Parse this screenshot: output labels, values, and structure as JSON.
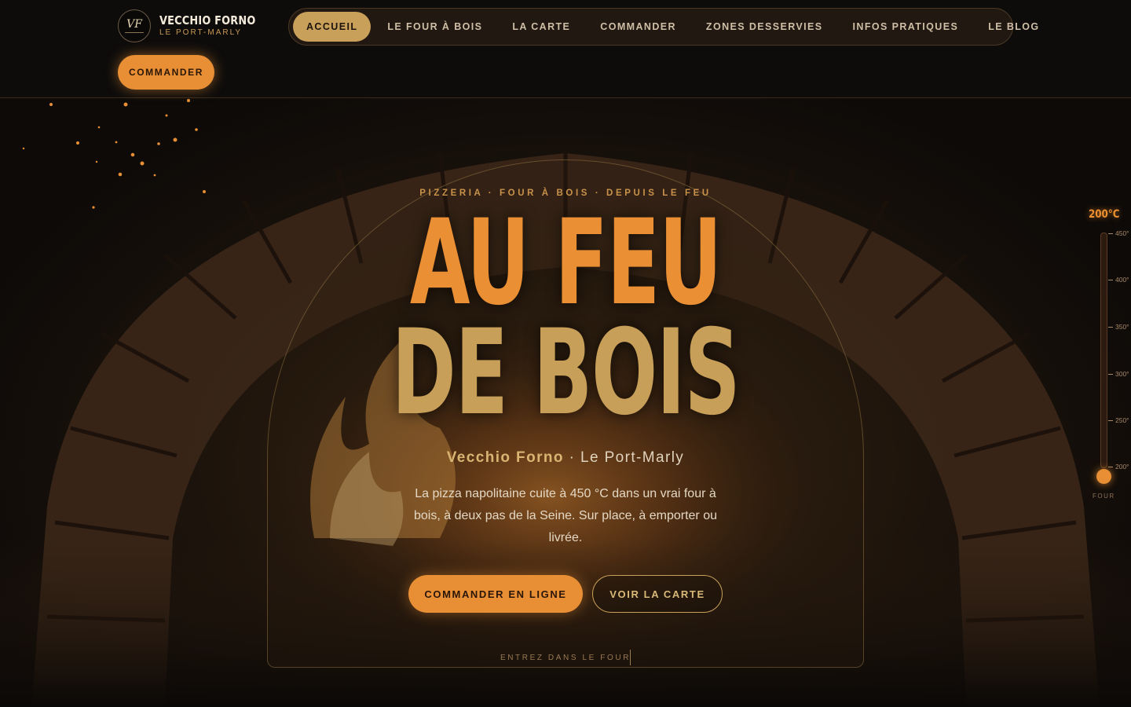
{
  "brand": {
    "monogram": "VF",
    "name": "VECCHIO FORNO",
    "location": "LE PORT-MARLY"
  },
  "nav": {
    "items": [
      {
        "label": "ACCUEIL",
        "active": true
      },
      {
        "label": "LE FOUR À BOIS",
        "active": false
      },
      {
        "label": "LA CARTE",
        "active": false
      },
      {
        "label": "COMMANDER",
        "active": false
      },
      {
        "label": "ZONES DESSERVIES",
        "active": false
      },
      {
        "label": "INFOS PRATIQUES",
        "active": false
      },
      {
        "label": "LE BLOG",
        "active": false
      }
    ]
  },
  "header_cta": {
    "label": "COMMANDER"
  },
  "hero": {
    "eyebrow": "PIZZERIA · FOUR À BOIS · DEPUIS LE FEU",
    "title_line1": "AU FEU",
    "title_line2": "DE BOIS",
    "subtitle_name": "Vecchio Forno",
    "subtitle_sep": " · ",
    "subtitle_place": "Le Port-Marly",
    "lead": "La pizza napolitaine cuite à 450 °C dans un vrai four à bois, à deux pas de la Seine. Sur place, à emporter ou livrée.",
    "primary_button": "COMMANDER EN LIGNE",
    "secondary_button": "VOIR LA CARTE",
    "scroll_cue": "ENTREZ DANS LE FOUR"
  },
  "thermometer": {
    "readout": "200°C",
    "value": 200,
    "min": 200,
    "max": 450,
    "ticks": [
      "450°",
      "400°",
      "350°",
      "300°",
      "250°",
      "200°"
    ],
    "label": "FOUR"
  },
  "colors": {
    "accent": "#e88f35",
    "gold": "#c9a05a",
    "background": "#0d0b0a"
  }
}
